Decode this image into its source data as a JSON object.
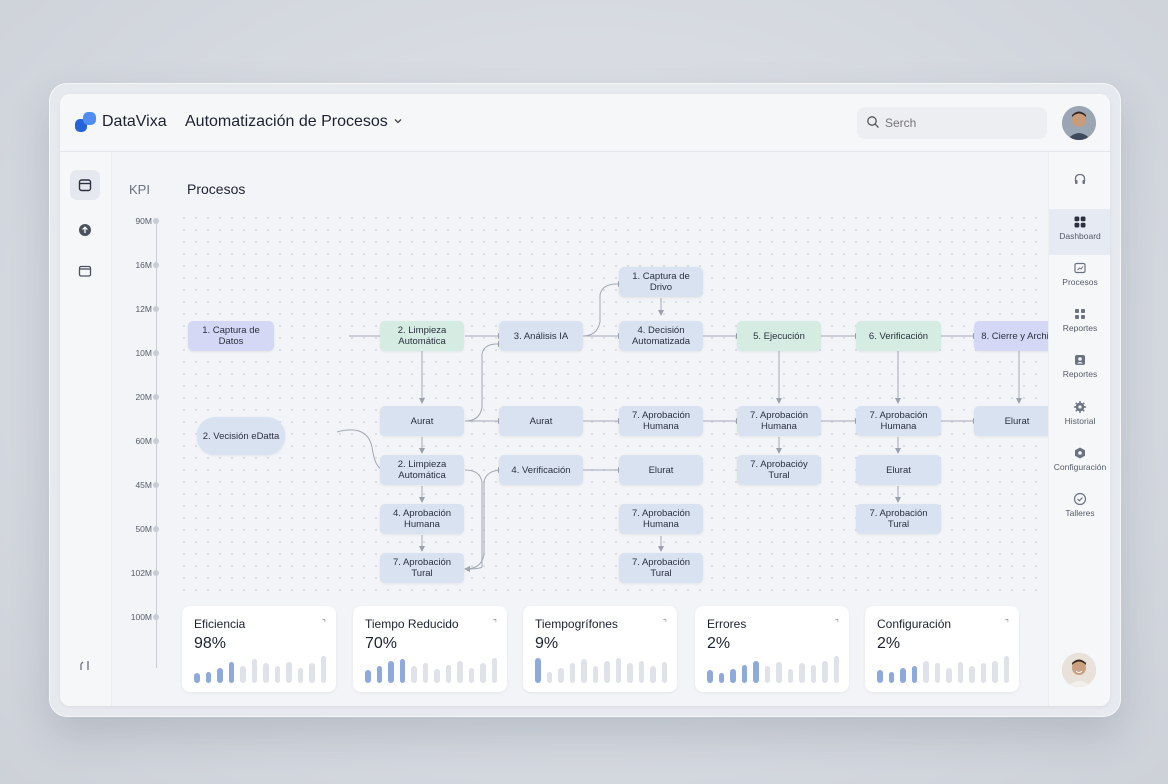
{
  "brand": "DataVixa",
  "app_title": "Automatización de Procesos",
  "search": {
    "placeholder": "Serch"
  },
  "colors": {
    "accent": "#2f6fe0",
    "node_blue": "#d8e2f1",
    "node_purple": "#d5d8f5",
    "node_green": "#d4ece1"
  },
  "left_sidebar": [
    {
      "icon": "calendar-icon",
      "active": true
    },
    {
      "icon": "upload-icon",
      "active": false
    },
    {
      "icon": "folder-icon",
      "active": false
    },
    {
      "icon": "expand-icon",
      "active": false
    }
  ],
  "right_sidebar": [
    {
      "icon": "headset-icon",
      "label": ""
    },
    {
      "icon": "dashboard-icon",
      "label": "Dashboard",
      "active": true
    },
    {
      "icon": "processes-icon",
      "label": "Procesos"
    },
    {
      "icon": "reports-icon",
      "label": "Reportes"
    },
    {
      "icon": "reports-alt-icon",
      "label": "Reportes"
    },
    {
      "icon": "gear-icon",
      "label": "Historial"
    },
    {
      "icon": "settings-icon",
      "label": "Configuración"
    },
    {
      "icon": "workshop-icon",
      "label": "Talleres"
    }
  ],
  "main": {
    "kpi_label": "KPI",
    "title": "Procesos",
    "axis_ticks": [
      "90M",
      "16M",
      "12M",
      "10M",
      "20M",
      "60M",
      "45M",
      "50M",
      "102M",
      "100M"
    ]
  },
  "nodes": [
    {
      "id": "n1",
      "label": "1. Captura de Datos"
    },
    {
      "id": "n2",
      "label": "2. Limpieza Automática"
    },
    {
      "id": "n3",
      "label": "3. Análisis IA"
    },
    {
      "id": "n4",
      "label": "1. Captura de Drivo"
    },
    {
      "id": "n5",
      "label": "4. Decisión Automatizada"
    },
    {
      "id": "n6",
      "label": "5. Ejecución"
    },
    {
      "id": "n7",
      "label": "6. Verificación"
    },
    {
      "id": "n8",
      "label": "8. Cierre y Archivo"
    },
    {
      "id": "n9",
      "label": "2. Vecisión eDatta"
    },
    {
      "id": "n10",
      "label": "Aurat"
    },
    {
      "id": "n11",
      "label": "Aurat"
    },
    {
      "id": "n12",
      "label": "7. Aprobación Humana"
    },
    {
      "id": "n13",
      "label": "7. Aprobación Humana"
    },
    {
      "id": "n14",
      "label": "7. Aprobación Humana"
    },
    {
      "id": "n15",
      "label": "Elurat"
    },
    {
      "id": "n16",
      "label": "2. Limpieza Automática"
    },
    {
      "id": "n17",
      "label": "4. Verificación"
    },
    {
      "id": "n18",
      "label": "Elurat"
    },
    {
      "id": "n19",
      "label": "7. Aprobacióy Tural"
    },
    {
      "id": "n20",
      "label": "Elurat"
    },
    {
      "id": "n21",
      "label": "4. Aprobación Humana"
    },
    {
      "id": "n22",
      "label": "7. Aprobación Humana"
    },
    {
      "id": "n23",
      "label": "7. Aprobación Tural"
    },
    {
      "id": "n24",
      "label": "7. Aprobación Tural"
    },
    {
      "id": "n25",
      "label": "7. Aprobación Tural"
    }
  ],
  "cards": [
    {
      "title": "Eficiencia",
      "value": "98%",
      "bars": [
        0.35,
        0.4,
        0.55,
        0.75,
        0.6,
        0.85,
        0.7,
        0.6,
        0.75,
        0.55,
        0.7,
        0.95
      ],
      "highlight": 4
    },
    {
      "title": "Tiempo Reducido",
      "value": "70%",
      "bars": [
        0.45,
        0.6,
        0.8,
        0.85,
        0.6,
        0.7,
        0.5,
        0.65,
        0.8,
        0.55,
        0.7,
        0.9
      ],
      "highlight": 4
    },
    {
      "title": "Tiempogrífones",
      "value": "9%",
      "bars": [
        0.9,
        0.4,
        0.55,
        0.7,
        0.85,
        0.6,
        0.8,
        0.9,
        0.7,
        0.8,
        0.6,
        0.75
      ],
      "highlight": 1
    },
    {
      "title": "Errores",
      "value": "2%",
      "bars": [
        0.45,
        0.35,
        0.5,
        0.65,
        0.8,
        0.6,
        0.75,
        0.5,
        0.7,
        0.65,
        0.8,
        0.95
      ],
      "highlight": 5
    },
    {
      "title": "Configuración",
      "value": "2%",
      "bars": [
        0.45,
        0.4,
        0.55,
        0.6,
        0.8,
        0.7,
        0.55,
        0.75,
        0.6,
        0.7,
        0.8,
        0.95
      ],
      "highlight": 4
    }
  ]
}
